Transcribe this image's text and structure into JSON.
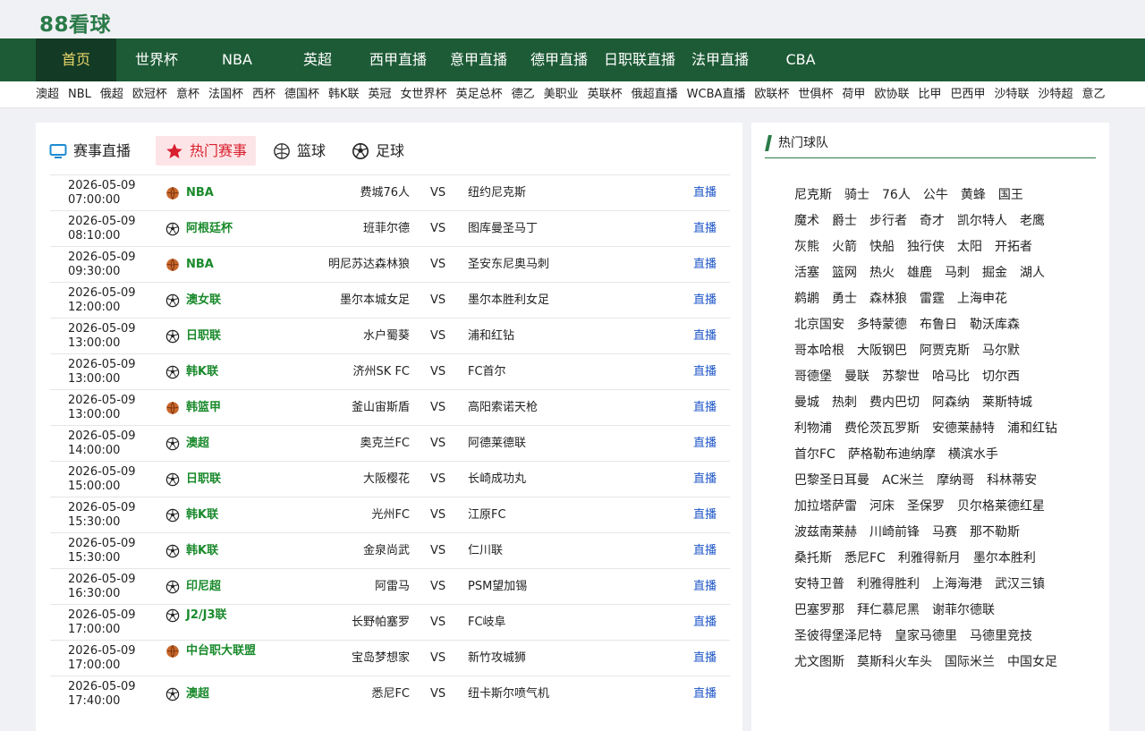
{
  "logo": "88看球",
  "nav": [
    {
      "label": "首页",
      "active": true
    },
    {
      "label": "世界杯"
    },
    {
      "label": "NBA"
    },
    {
      "label": "英超"
    },
    {
      "label": "西甲直播"
    },
    {
      "label": "意甲直播"
    },
    {
      "label": "德甲直播"
    },
    {
      "label": "日职联直播"
    },
    {
      "label": "法甲直播"
    },
    {
      "label": "CBA"
    }
  ],
  "subnav": [
    "澳超",
    "NBL",
    "俄超",
    "欧冠杯",
    "意杯",
    "法国杯",
    "西杯",
    "德国杯",
    "韩K联",
    "英冠",
    "女世界杯",
    "英足总杯",
    "德乙",
    "美职业",
    "英联杯",
    "俄超直播",
    "WCBA直播",
    "欧联杯",
    "世俱杯",
    "荷甲",
    "欧协联",
    "比甲",
    "巴西甲",
    "沙特联",
    "沙特超",
    "意乙"
  ],
  "tabs": [
    {
      "label": "赛事直播",
      "icon": "monitor-icon"
    },
    {
      "label": "热门赛事",
      "icon": "star-icon",
      "active": true
    },
    {
      "label": "篮球",
      "icon": "basketball-outline-icon"
    },
    {
      "label": "足球",
      "icon": "soccer-ball-icon"
    }
  ],
  "live_label": "直播",
  "vs_label": "VS",
  "matches": [
    {
      "date": "2026-05-09",
      "time": "07:00:00",
      "sport": "basketball",
      "league": "NBA",
      "home": "费城76人",
      "away": "纽约尼克斯"
    },
    {
      "date": "2026-05-09",
      "time": "08:10:00",
      "sport": "soccer",
      "league": "阿根廷杯",
      "home": "班菲尔德",
      "away": "图库曼圣马丁"
    },
    {
      "date": "2026-05-09",
      "time": "09:30:00",
      "sport": "basketball",
      "league": "NBA",
      "home": "明尼苏达森林狼",
      "away": "圣安东尼奥马刺"
    },
    {
      "date": "2026-05-09",
      "time": "12:00:00",
      "sport": "soccer",
      "league": "澳女联",
      "home": "墨尔本城女足",
      "away": "墨尔本胜利女足"
    },
    {
      "date": "2026-05-09",
      "time": "13:00:00",
      "sport": "soccer",
      "league": "日职联",
      "home": "水户蜀葵",
      "away": "浦和红钻"
    },
    {
      "date": "2026-05-09",
      "time": "13:00:00",
      "sport": "soccer",
      "league": "韩K联",
      "home": "济州SK FC",
      "away": "FC首尔"
    },
    {
      "date": "2026-05-09",
      "time": "13:00:00",
      "sport": "basketball",
      "league": "韩篮甲",
      "home": "釜山宙斯盾",
      "away": "高阳索诺天枪"
    },
    {
      "date": "2026-05-09",
      "time": "14:00:00",
      "sport": "soccer",
      "league": "澳超",
      "home": "奥克兰FC",
      "away": "阿德莱德联"
    },
    {
      "date": "2026-05-09",
      "time": "15:00:00",
      "sport": "soccer",
      "league": "日职联",
      "home": "大阪樱花",
      "away": "长崎成功丸"
    },
    {
      "date": "2026-05-09",
      "time": "15:30:00",
      "sport": "soccer",
      "league": "韩K联",
      "home": "光州FC",
      "away": "江原FC"
    },
    {
      "date": "2026-05-09",
      "time": "15:30:00",
      "sport": "soccer",
      "league": "韩K联",
      "home": "金泉尚武",
      "away": "仁川联"
    },
    {
      "date": "2026-05-09",
      "time": "16:30:00",
      "sport": "soccer",
      "league": "印尼超",
      "home": "阿雷马",
      "away": "PSM望加锡"
    },
    {
      "date": "2026-05-09",
      "time": "17:00:00",
      "sport": "soccer",
      "league": "J2/J3联",
      "home": "长野帕塞罗",
      "away": "FC岐阜"
    },
    {
      "date": "2026-05-09",
      "time": "17:00:00",
      "sport": "basketball",
      "league": "中台职大联盟",
      "home": "宝岛梦想家",
      "away": "新竹攻城狮"
    },
    {
      "date": "2026-05-09",
      "time": "17:40:00",
      "sport": "soccer",
      "league": "澳超",
      "home": "悉尼FC",
      "away": "纽卡斯尔喷气机"
    }
  ],
  "side_title": "热门球队",
  "teams": [
    [
      "尼克斯",
      "骑士",
      "76人",
      "公牛",
      "黄蜂",
      "国王"
    ],
    [
      "魔术",
      "爵士",
      "步行者",
      "奇才",
      "凯尔特人",
      "老鹰"
    ],
    [
      "灰熊",
      "火箭",
      "快船",
      "独行侠",
      "太阳",
      "开拓者"
    ],
    [
      "活塞",
      "篮网",
      "热火",
      "雄鹿",
      "马刺",
      "掘金",
      "湖人"
    ],
    [
      "鹈鹕",
      "勇士",
      "森林狼",
      "雷霆",
      "上海申花"
    ],
    [
      "北京国安",
      "多特蒙德",
      "布鲁日",
      "勒沃库森"
    ],
    [
      "哥本哈根",
      "大阪钢巴",
      "阿贾克斯",
      "马尔默"
    ],
    [
      "哥德堡",
      "曼联",
      "苏黎世",
      "哈马比",
      "切尔西"
    ],
    [
      "曼城",
      "热刺",
      "费内巴切",
      "阿森纳",
      "莱斯特城"
    ],
    [
      "利物浦",
      "费伦茨瓦罗斯",
      "安德莱赫特",
      "浦和红钻"
    ],
    [
      "首尔FC",
      "萨格勒布迪纳摩",
      "横滨水手"
    ],
    [
      "巴黎圣日耳曼",
      "AC米兰",
      "摩纳哥",
      "科林蒂安"
    ],
    [
      "加拉塔萨雷",
      "河床",
      "圣保罗",
      "贝尔格莱德红星"
    ],
    [
      "波兹南莱赫",
      "川崎前锋",
      "马赛",
      "那不勒斯"
    ],
    [
      "桑托斯",
      "悉尼FC",
      "利雅得新月",
      "墨尔本胜利"
    ],
    [
      "安特卫普",
      "利雅得胜利",
      "上海海港",
      "武汉三镇"
    ],
    [
      "巴塞罗那",
      "拜仁慕尼黑",
      "谢菲尔德联"
    ],
    [
      "圣彼得堡泽尼特",
      "皇家马德里",
      "马德里竞技"
    ],
    [
      "尤文图斯",
      "莫斯科火车头",
      "国际米兰",
      "中国女足"
    ]
  ],
  "colors": {
    "nav_bg": "#1d5b36",
    "nav_active": "#133a24",
    "accent_green": "#2a7a48",
    "league_green": "#1a8a2c",
    "live_blue": "#1e56c8",
    "hot_red": "#d9202f"
  }
}
